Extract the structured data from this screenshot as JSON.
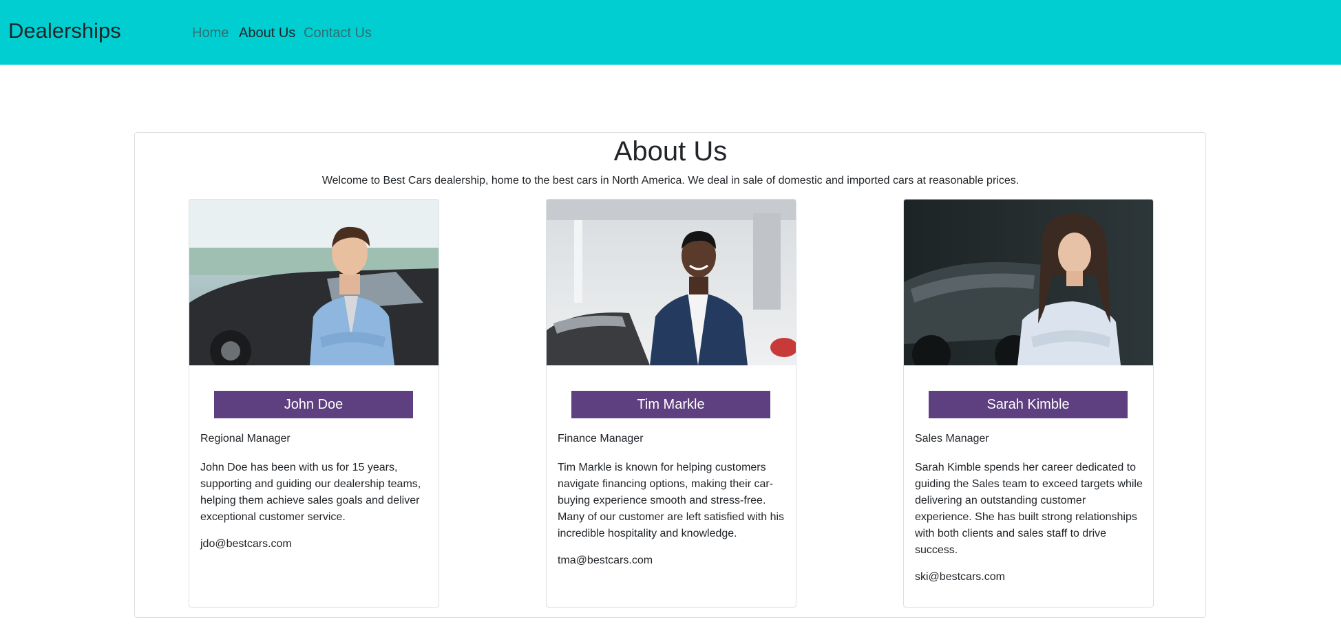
{
  "navbar": {
    "brand": "Dealerships",
    "links": [
      {
        "label": "Home",
        "active": false
      },
      {
        "label": "About Us",
        "active": true
      },
      {
        "label": "Contact Us",
        "active": false
      }
    ],
    "background_color": "#00ced1"
  },
  "about": {
    "title": "About Us",
    "intro": "Welcome to Best Cars dealership, home to the best cars in North America. We deal in sale of domestic and imported cars at reasonable prices."
  },
  "team": [
    {
      "name": "John Doe",
      "role": "Regional Manager",
      "bio": "John Doe has been with us for 15 years, supporting and guiding our dealership teams, helping them achieve sales goals and deliver exceptional customer service.",
      "email": "jdo@bestcars.com",
      "photo": "man-in-light-blue-shirt-with-car-photo"
    },
    {
      "name": "Tim Markle",
      "role": "Finance Manager",
      "bio": "Tim Markle is known for helping customers navigate financing options, making their car-buying experience smooth and stress-free. Many of our customer are left satisfied with his incredible hospitality and knowledge.",
      "email": "tma@bestcars.com",
      "photo": "man-in-navy-suit-showroom-photo"
    },
    {
      "name": "Sarah Kimble",
      "role": "Sales Manager",
      "bio": "Sarah Kimble spends her career dedicated to guiding the Sales team to exceed targets while delivering an outstanding customer experience. She has built strong relationships with both clients and sales staff to drive success.",
      "email": "ski@bestcars.com",
      "photo": "woman-in-white-blouse-showroom-photo"
    }
  ],
  "colors": {
    "name_badge": "#5e3f7f",
    "navbar": "#00ced1"
  }
}
